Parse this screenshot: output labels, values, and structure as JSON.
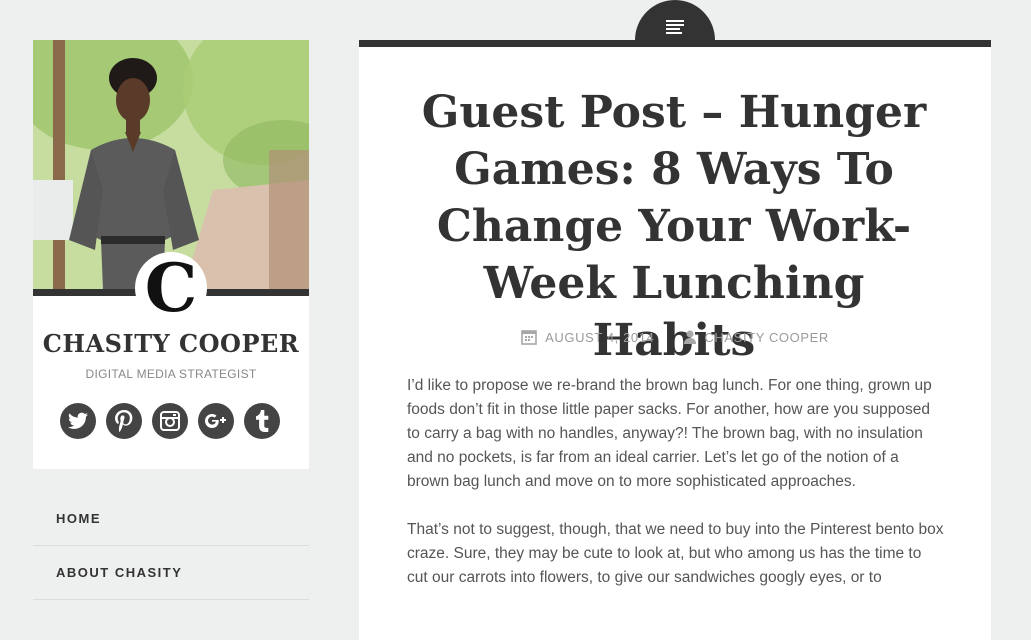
{
  "sidebar": {
    "logo_letter": "C",
    "site_title": "CHASITY COOPER",
    "tagline": "DIGITAL MEDIA STRATEGIST",
    "social_icons": [
      "twitter-icon",
      "pinterest-icon",
      "instagram-icon",
      "google-plus-icon",
      "tumblr-icon"
    ],
    "nav": [
      {
        "label": "HOME"
      },
      {
        "label": "ABOUT CHASITY"
      }
    ]
  },
  "post": {
    "format_icon": "standard-post-icon",
    "title": "Guest Post – Hunger Games: 8 Ways To Change Your Work-Week Lunching Habits",
    "date": "AUGUST 4, 2014",
    "author": "CHASITY COOPER",
    "paragraphs": [
      "I’d like to propose we re-brand the brown bag lunch. For one thing, grown up foods don’t fit in those little paper sacks. For another, how are you supposed to carry a bag with no handles, anyway?! The brown bag, with no insulation and no pockets, is far from an ideal carrier. Let’s let go of the notion of a brown bag lunch and move on to more sophisticated approaches.",
      "That’s not to suggest, though, that we need to buy into the Pinterest bento box craze. Sure, they may be cute to look at, but who among us has the time to cut our carrots into flowers, to give our sandwiches googly eyes, or to"
    ]
  }
}
